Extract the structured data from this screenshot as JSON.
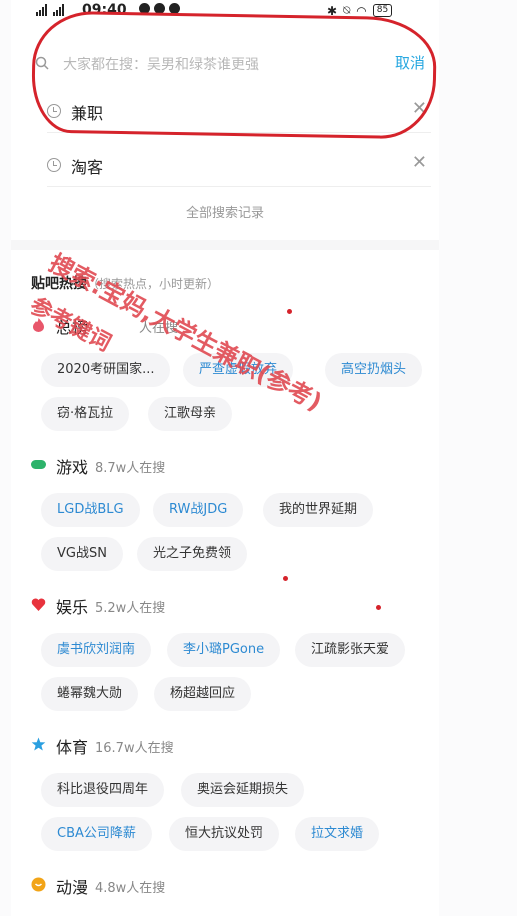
{
  "status_bar": {
    "signal": "4G 4G",
    "time": "09:40",
    "battery": "85"
  },
  "search": {
    "placeholder": "大家都在搜：吴男和绿茶谁更强",
    "cancel_label": "取消"
  },
  "history": [
    {
      "label": "兼职"
    },
    {
      "label": "淘客"
    }
  ],
  "all_history_label": "全部搜索记录",
  "hot": {
    "title": "贴吧热搜",
    "subtitle": "（搜索热点，小时更新）",
    "categories": [
      {
        "name": "总榜",
        "count": "人在搜",
        "color": "#e8566a",
        "chips": [
          {
            "label": "2020考研国家...",
            "style": "normal"
          },
          {
            "label": "严查虚假放弃",
            "style": "blue"
          },
          {
            "label": "高空扔烟头",
            "style": "blue"
          },
          {
            "label": "窃·格瓦拉",
            "style": "normal"
          },
          {
            "label": "江歌母亲",
            "style": "normal"
          }
        ]
      },
      {
        "name": "游戏",
        "count": "8.7w人在搜",
        "color": "#2db36b",
        "chips": [
          {
            "label": "LGD战BLG",
            "style": "blue"
          },
          {
            "label": "RW战JDG",
            "style": "blue"
          },
          {
            "label": "我的世界延期",
            "style": "normal"
          },
          {
            "label": "VG战SN",
            "style": "normal"
          },
          {
            "label": "光之子免费领",
            "style": "normal"
          }
        ]
      },
      {
        "name": "娱乐",
        "count": "5.2w人在搜",
        "color": "#e8333d",
        "chips": [
          {
            "label": "虞书欣刘润南",
            "style": "blue"
          },
          {
            "label": "李小璐PGone",
            "style": "blue"
          },
          {
            "label": "江疏影张天爱",
            "style": "normal"
          },
          {
            "label": "蜷幂魏大勋",
            "style": "normal"
          },
          {
            "label": "杨超越回应",
            "style": "normal"
          }
        ]
      },
      {
        "name": "体育",
        "count": "16.7w人在搜",
        "color": "#2a9fe0",
        "chips": [
          {
            "label": "科比退役四周年",
            "style": "normal"
          },
          {
            "label": "奥运会延期损失",
            "style": "normal"
          },
          {
            "label": "CBA公司降薪",
            "style": "blue"
          },
          {
            "label": "恒大抗议处罚",
            "style": "normal"
          },
          {
            "label": "拉文求婚",
            "style": "blue"
          }
        ]
      },
      {
        "name": "动漫",
        "count": "4.8w人在搜",
        "color": "#f2a417",
        "chips": []
      }
    ]
  },
  "watermark": {
    "line1": "搜索:宝妈,大学生兼职(参考)",
    "line2": "参考键词"
  }
}
